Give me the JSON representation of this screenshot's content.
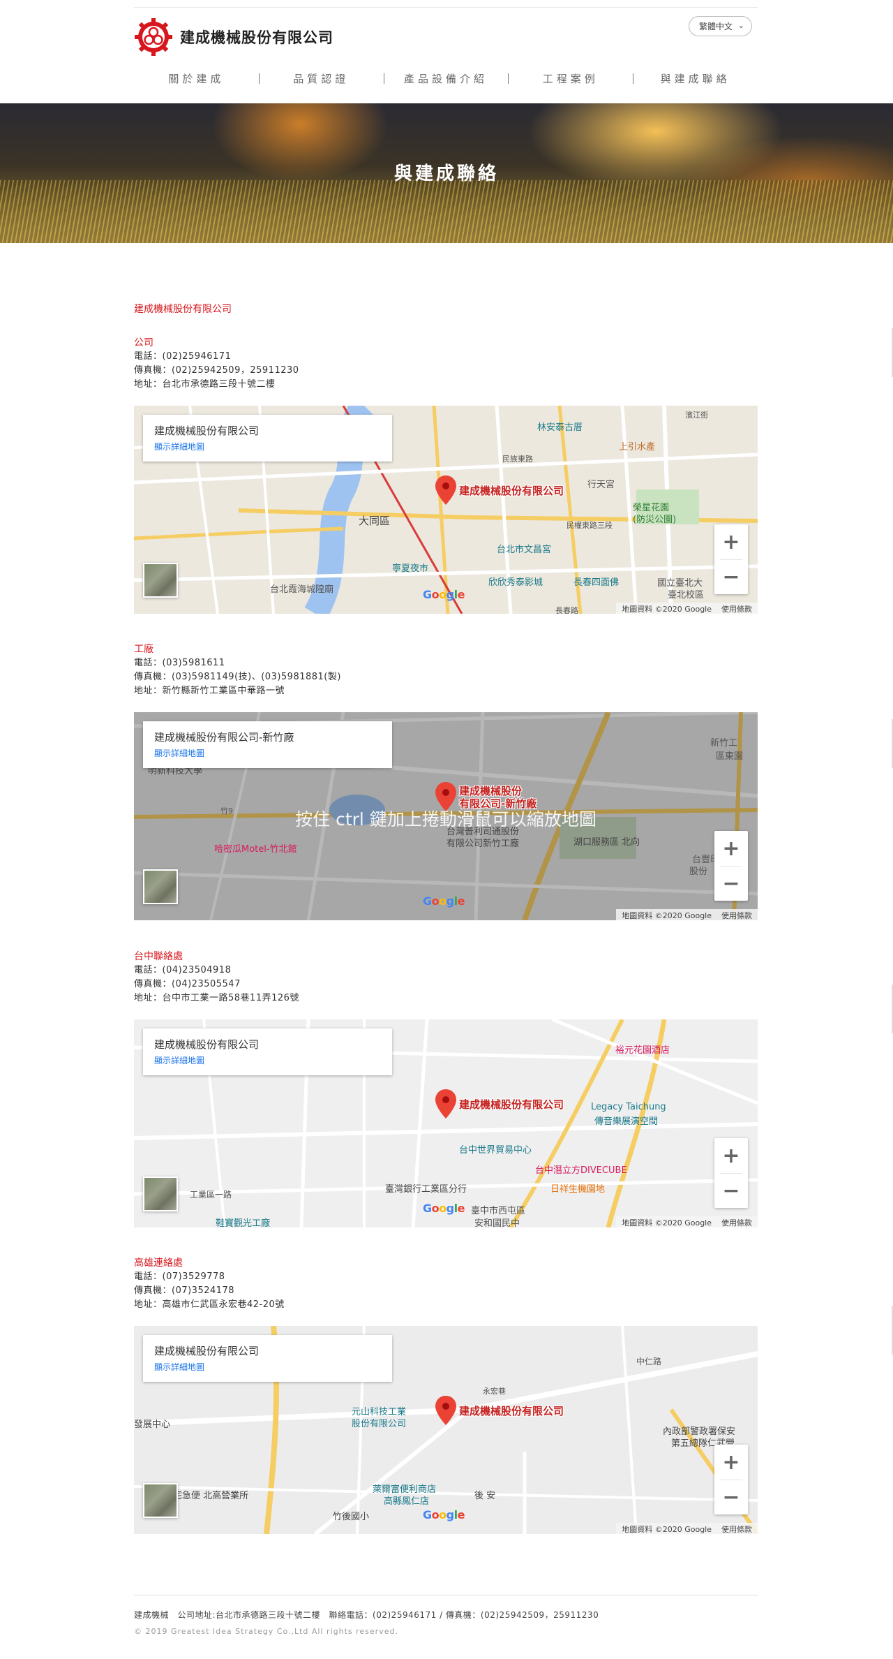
{
  "brand": {
    "name": "建成機械股份有限公司",
    "accent": "#d6171e"
  },
  "language": {
    "selected": "繁體中文"
  },
  "nav": [
    "關於建成",
    "品質認證",
    "產品設備介紹",
    "工程案例",
    "與建成聯絡"
  ],
  "banner": {
    "title": "與建成聯絡"
  },
  "company_heading": "建成機械股份有限公司",
  "locations": [
    {
      "title": "公司",
      "phone": "電話：(02)25946171",
      "fax": "傳真機：(02)25942509，25911230",
      "address": "地址：台北市承德路三段十號二樓",
      "map": {
        "card_name": "建成機械股份有限公司",
        "card_link": "顯示詳細地圖",
        "pin_label": "建成機械股份有限公司",
        "places": [
          "林安泰古厝",
          "上引水產",
          "大同區",
          "台北市文昌宮",
          "寧夏夜市",
          "欣欣秀泰影城",
          "長春四面佛",
          "國立臺北大",
          "臺北校區",
          "台北霞海城隍廟",
          "行天宮",
          "榮星花園",
          "(防災公園)",
          "民權東路三段",
          "長春路",
          "民族東路",
          "濱江街"
        ],
        "attribution": "地圖資料 ©2020 Google",
        "terms": "使用條款"
      }
    },
    {
      "title": "工廠",
      "phone": "電話：(03)5981611",
      "fax": "傳真機：(03)5981149(技)、(03)5981881(製)",
      "address": "地址：新竹縣新竹工業區中華路一號",
      "map": {
        "card_name": "建成機械股份有限公司-新竹廠",
        "card_link": "顯示詳細地圖",
        "pin_label": "建成機械股份\n有限公司-新竹廠",
        "places": [
          "明新科技大學",
          "哈密瓜Motel-竹北館",
          "台灣普利司通股份",
          "有限公司新竹工廠",
          "湖口服務區 北向",
          "台豐印",
          "股份",
          "新竹工",
          "區東園",
          "竹9"
        ],
        "overlay": "按住 ctrl 鍵加上捲動滑鼠可以縮放地圖",
        "attribution": "地圖資料 ©2020 Google",
        "terms": "使用條款"
      }
    },
    {
      "title": "台中聯絡處",
      "phone": "電話：(04)23504918",
      "fax": "傳真機：(04)23505547",
      "address": "地址：台中市工業一路58巷11弄126號",
      "map": {
        "card_name": "建成機械股份有限公司",
        "card_link": "顯示詳細地圖",
        "pin_label": "建成機械股份有限公司",
        "places": [
          "裕元花園酒店",
          "Legacy Taichung",
          "傳音樂展演空間",
          "台中世界貿易中心",
          "台中潛立方DIVECUBE",
          "臺灣銀行工業區分行",
          "日祥生機園地",
          "臺中市西屯區",
          "安和國民中",
          "鞋寶觀光工廠",
          "工業區一路"
        ],
        "attribution": "地圖資料 ©2020 Google",
        "terms": "使用條款"
      }
    },
    {
      "title": "高雄連絡處",
      "phone": "電話：(07)3529778",
      "fax": "傳真機：(07)3524178",
      "address": "地址：高雄市仁武區永宏巷42-20號",
      "map": {
        "card_name": "建成機械股份有限公司",
        "card_link": "顯示詳細地圖",
        "pin_label": "建成機械股份有限公司",
        "places": [
          "元山科技工業",
          "股份有限公司",
          "萊爾富便利商店",
          "高縣鳳仁店",
          "宅急便 北高營業所",
          "竹後國小",
          "後 安",
          "內政部警政署保安",
          "第五總隊仁武營",
          "發展中心",
          "中仁路",
          "永宏巷"
        ],
        "attribution": "地圖資料 ©2020 Google",
        "terms": "使用條款"
      }
    }
  ],
  "footer": {
    "line1": "建成機械　公司地址:台北市承德路三段十號二樓　聯絡電話：(02)25946171 / 傳真機：(02)25942509，25911230",
    "line2": "© 2019 Greatest Idea Strategy Co.,Ltd All rights reserved."
  }
}
